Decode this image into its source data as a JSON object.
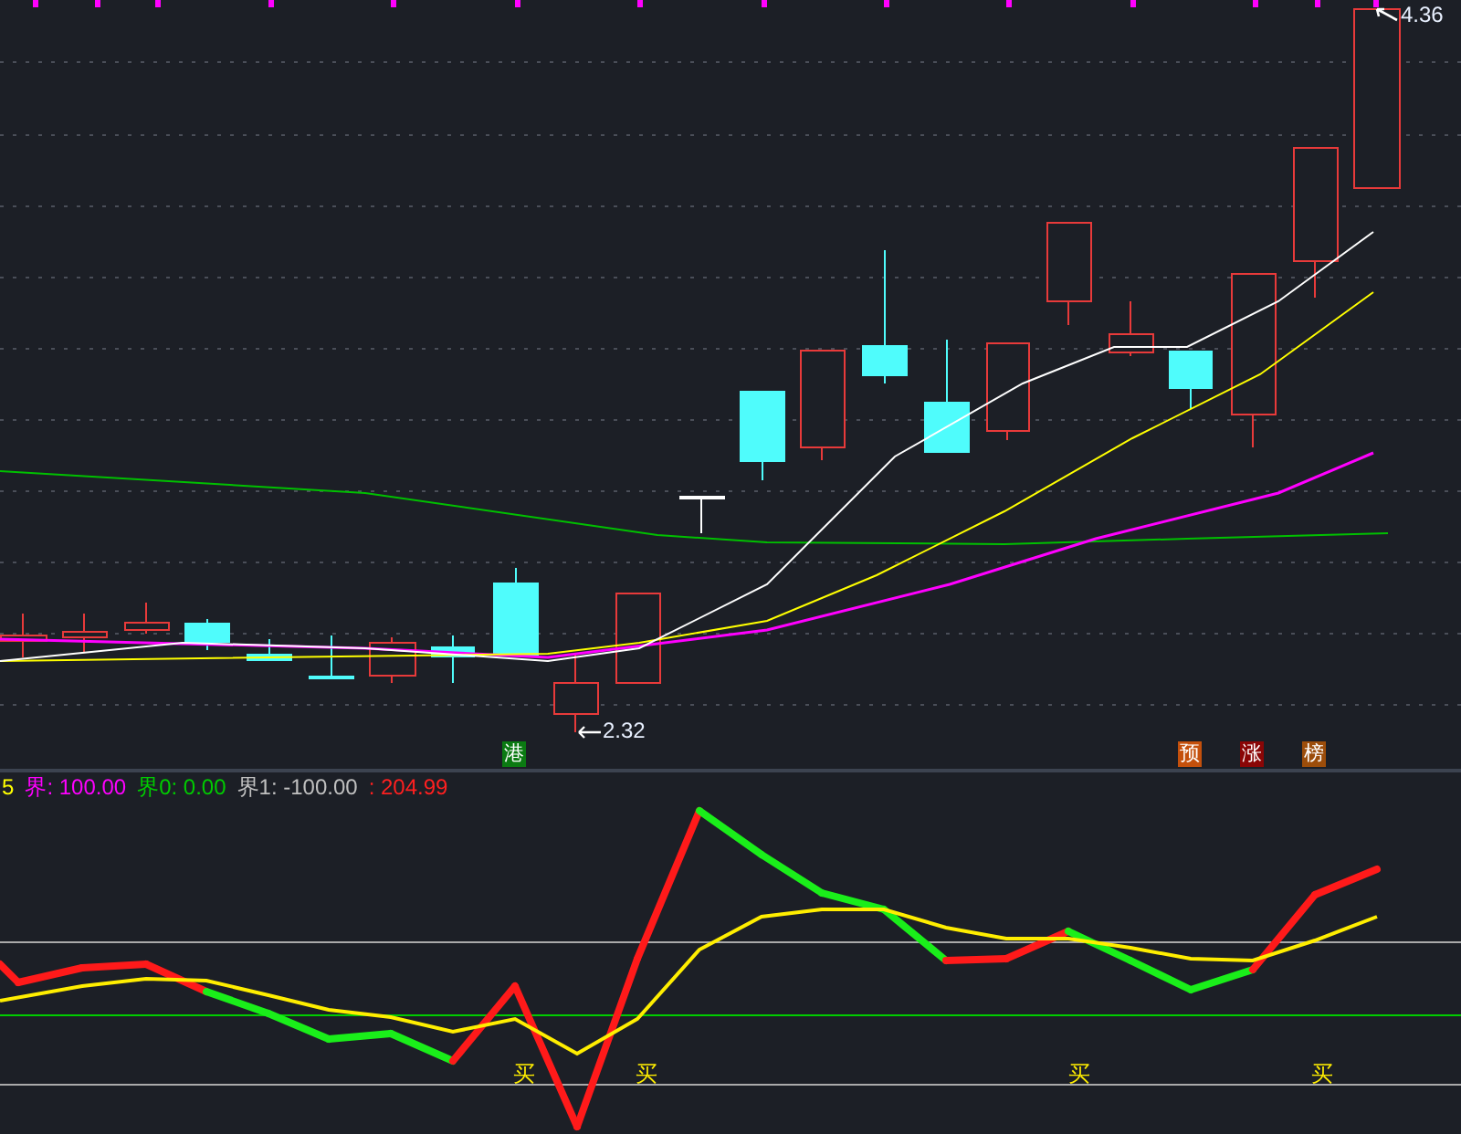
{
  "price_panel": {
    "high_label": "4.36",
    "low_label": "2.32",
    "markers": [
      {
        "text": "港",
        "color": "#0b7a12"
      },
      {
        "text": "预",
        "color": "#c4500c"
      },
      {
        "text": "涨",
        "color": "#8a0606"
      },
      {
        "text": "榜",
        "color": "#9c4d0a"
      }
    ]
  },
  "indicator_header": [
    {
      "text": "5",
      "color": "#ffff00"
    },
    {
      "text": "界: 100.00",
      "color": "#ff00ff"
    },
    {
      "text": "界0: 0.00",
      "color": "#00cc00"
    },
    {
      "text": "界1: -100.00",
      "color": "#c0c0c0"
    },
    {
      "text": ": 204.99",
      "color": "#ff2020"
    }
  ],
  "indicator_panel": {
    "signals": [
      "买",
      "买",
      "买",
      "买"
    ]
  }
}
